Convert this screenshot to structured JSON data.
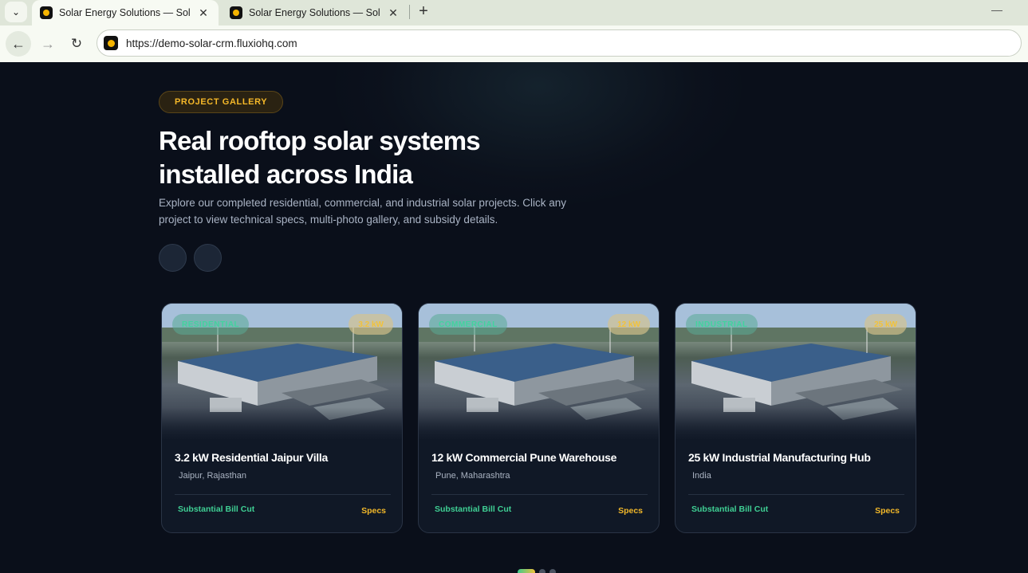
{
  "browser": {
    "tabs": [
      {
        "title": "Solar Energy Solutions — Solar",
        "active": true
      },
      {
        "title": "Solar Energy Solutions — Solar",
        "active": false
      }
    ],
    "url": "https://demo-solar-crm.fluxiohq.com"
  },
  "hero": {
    "badge": "PROJECT GALLERY",
    "headline_line1": "Real rooftop solar systems",
    "headline_line2": "installed across India",
    "description": "Explore our completed residential, commercial, and industrial solar projects. Click any project to view technical specs, multi-photo gallery, and subsidy details."
  },
  "projects": [
    {
      "category": "RESIDENTIAL",
      "capacity": "3.2 kW",
      "title": "3.2 kW Residential Jaipur Villa",
      "location": "Jaipur, Rajasthan",
      "benefit": "Substantial Bill Cut",
      "specs_label": "Specs"
    },
    {
      "category": "COMMERCIAL",
      "capacity": "12 kW",
      "title": "12 kW Commercial Pune Warehouse",
      "location": "Pune, Maharashtra",
      "benefit": "Substantial Bill Cut",
      "specs_label": "Specs"
    },
    {
      "category": "INDUSTRIAL",
      "capacity": "25 kW",
      "title": "25 kW Industrial Manufacturing Hub",
      "location": "India",
      "benefit": "Substantial Bill Cut",
      "specs_label": "Specs"
    }
  ],
  "pagination": {
    "total": 3,
    "active": 1
  },
  "colors": {
    "accent_gold": "#f2b829",
    "accent_green": "#3fcf94",
    "background": "#0a0f1a"
  }
}
